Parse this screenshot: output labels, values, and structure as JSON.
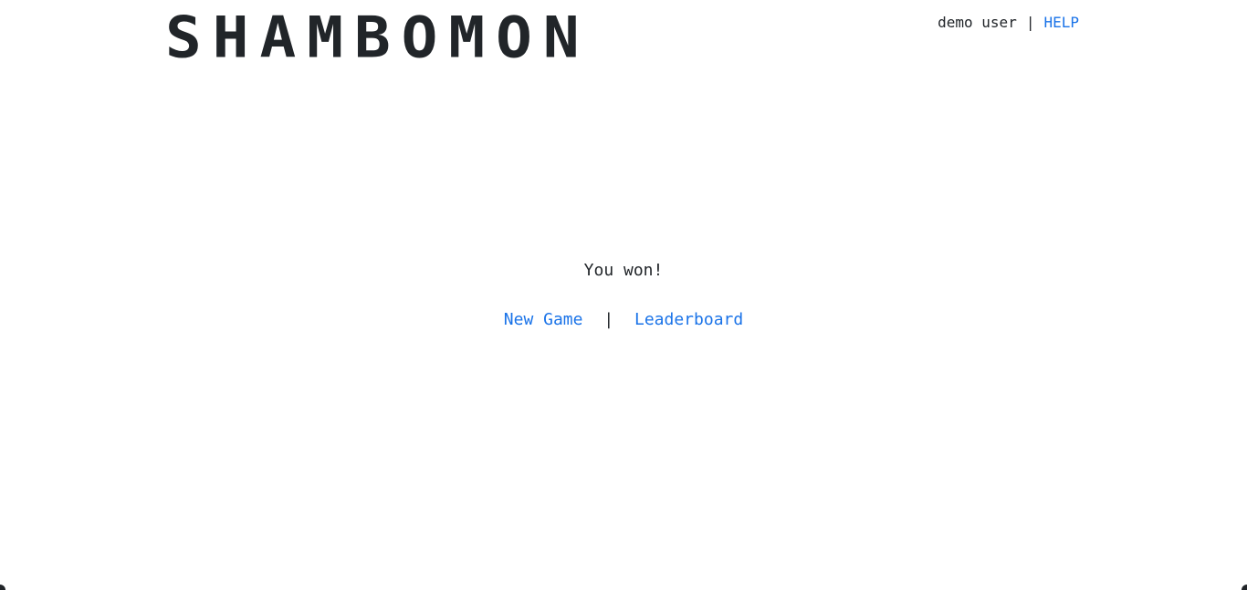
{
  "header": {
    "logo_text": "SHAMBOMON",
    "user_name": "demo user",
    "separator": "|",
    "help_label": "HELP"
  },
  "game": {
    "result_text": "You won!",
    "new_game_label": "New Game",
    "separator": "|",
    "leaderboard_label": "Leaderboard"
  },
  "colors": {
    "text": "#212529",
    "link": "#1a73e8",
    "background": "#ffffff"
  }
}
